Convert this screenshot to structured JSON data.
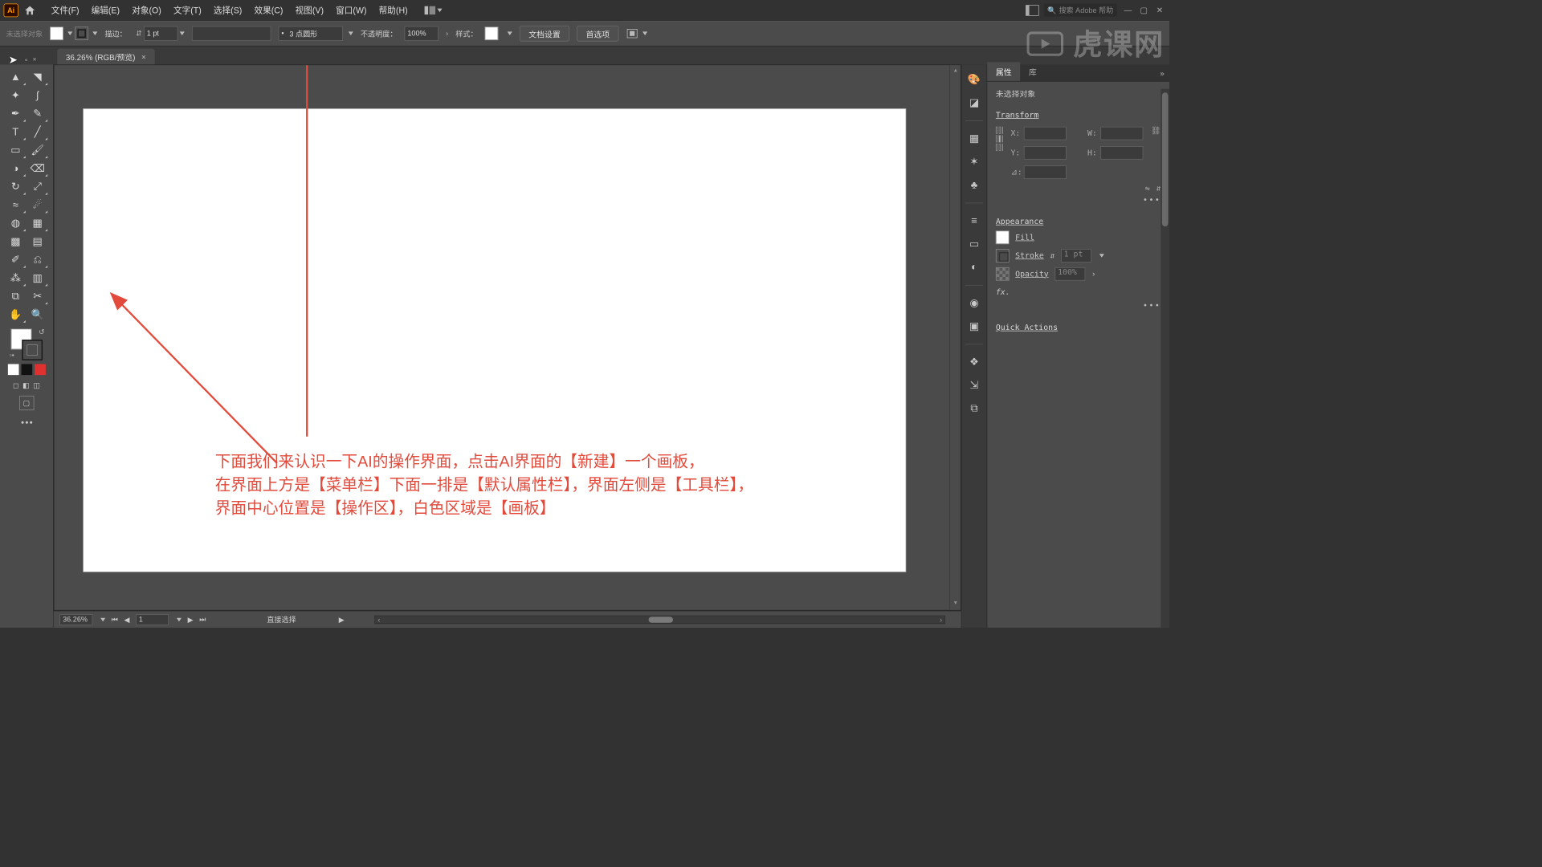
{
  "titlebar": {
    "logo": "Ai",
    "menus": [
      "文件(F)",
      "编辑(E)",
      "对象(O)",
      "文字(T)",
      "选择(S)",
      "效果(C)",
      "视图(V)",
      "窗口(W)",
      "帮助(H)"
    ],
    "search_placeholder": "搜索 Adobe 帮助"
  },
  "ctrlbar": {
    "no_selection": "未选择对象",
    "stroke_label": "描边：",
    "stroke_value": "1 pt",
    "dash_label": "3 点圆形",
    "opacity_label": "不透明度：",
    "opacity_value": "100%",
    "style_label": "样式：",
    "btn_docsetup": "文档设置",
    "btn_prefs": "首选项"
  },
  "doc_tab": {
    "title": "36.26% (RGB/预览)"
  },
  "tools": {
    "names": [
      "selection",
      "direct-selection",
      "magic-wand",
      "lasso",
      "pen",
      "curvature",
      "type",
      "line",
      "rectangle",
      "paintbrush",
      "ellipse",
      "shape-builder",
      "rotate",
      "scale",
      "width",
      "free-transform",
      "eraser",
      "perspective",
      "mesh",
      "gradient",
      "eyedropper",
      "blend",
      "symbol-sprayer",
      "column-graph",
      "artboard",
      "slice",
      "hand",
      "zoom"
    ]
  },
  "panels": {
    "tabs": [
      "属性",
      "库"
    ],
    "no_selection": "未选择对象",
    "transform_title": "Transform",
    "appearance_title": "Appearance",
    "fill_label": "Fill",
    "stroke_label": "Stroke",
    "stroke_value": "1 pt",
    "opacity_label": "Opacity",
    "opacity_value": "100%",
    "fx_label": "fx.",
    "quick_actions": "Quick Actions",
    "tf": {
      "X": "X:",
      "Y": "Y:",
      "W": "W:",
      "H": "H:",
      "A": "⊿:"
    }
  },
  "statusbar": {
    "zoom": "36.26%",
    "page": "1",
    "mode": "直接选择"
  },
  "annotation": {
    "line1": "下面我们来认识一下AI的操作界面，点击AI界面的【新建】一个画板，",
    "line2": "在界面上方是【菜单栏】下面一排是【默认属性栏】，界面左侧是【工具栏】，",
    "line3": "界面中心位置是【操作区】，白色区域是【画板】"
  },
  "watermark": "虎课网"
}
